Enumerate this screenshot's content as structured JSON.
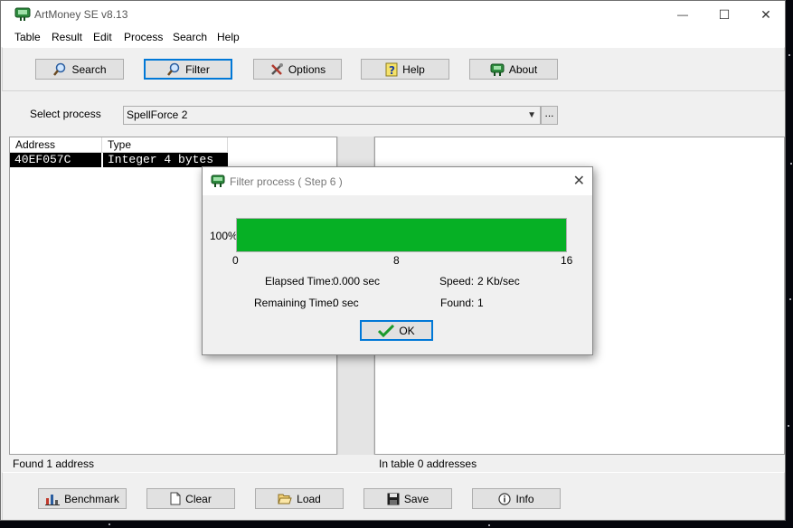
{
  "window": {
    "title": "ArtMoney SE v8.13",
    "controls": {
      "minimize": "—",
      "maximize": "☐",
      "close": "✕"
    }
  },
  "menu": [
    "Table",
    "Result",
    "Edit",
    "Process",
    "Search",
    "Help"
  ],
  "toolbar": {
    "search_label": "Search",
    "filter_label": "Filter",
    "options_label": "Options",
    "help_label": "Help",
    "about_label": "About"
  },
  "process": {
    "label": "Select process",
    "selected": "SpellForce 2",
    "browse_label": "..."
  },
  "left_table": {
    "columns": [
      "Address",
      "Type"
    ],
    "rows": [
      {
        "address": "40EF057C",
        "type": "Integer 4 bytes"
      }
    ],
    "status": "Found 1 address"
  },
  "right_table": {
    "status": "In table 0 addresses"
  },
  "bottom_buttons": {
    "benchmark": "Benchmark",
    "clear": "Clear",
    "load": "Load",
    "save": "Save",
    "info": "Info"
  },
  "dialog": {
    "title": "Filter process ( Step 6 )",
    "close": "✕",
    "progress_percent_label": "100%",
    "progress_fraction": 1.0,
    "progress_ticks": [
      "0",
      "8",
      "16"
    ],
    "elapsed_label": "Elapsed Time:",
    "elapsed_value": "0.000 sec",
    "remaining_label": "Remaining Time:",
    "remaining_value": "0 sec",
    "speed_label": "Speed:",
    "speed_value": "2 Kb/sec",
    "found_label": "Found:",
    "found_value": "1",
    "ok_label": "OK"
  },
  "colors": {
    "progress": "#06b025",
    "focus_border": "#0078d7",
    "selection": "#000000"
  }
}
